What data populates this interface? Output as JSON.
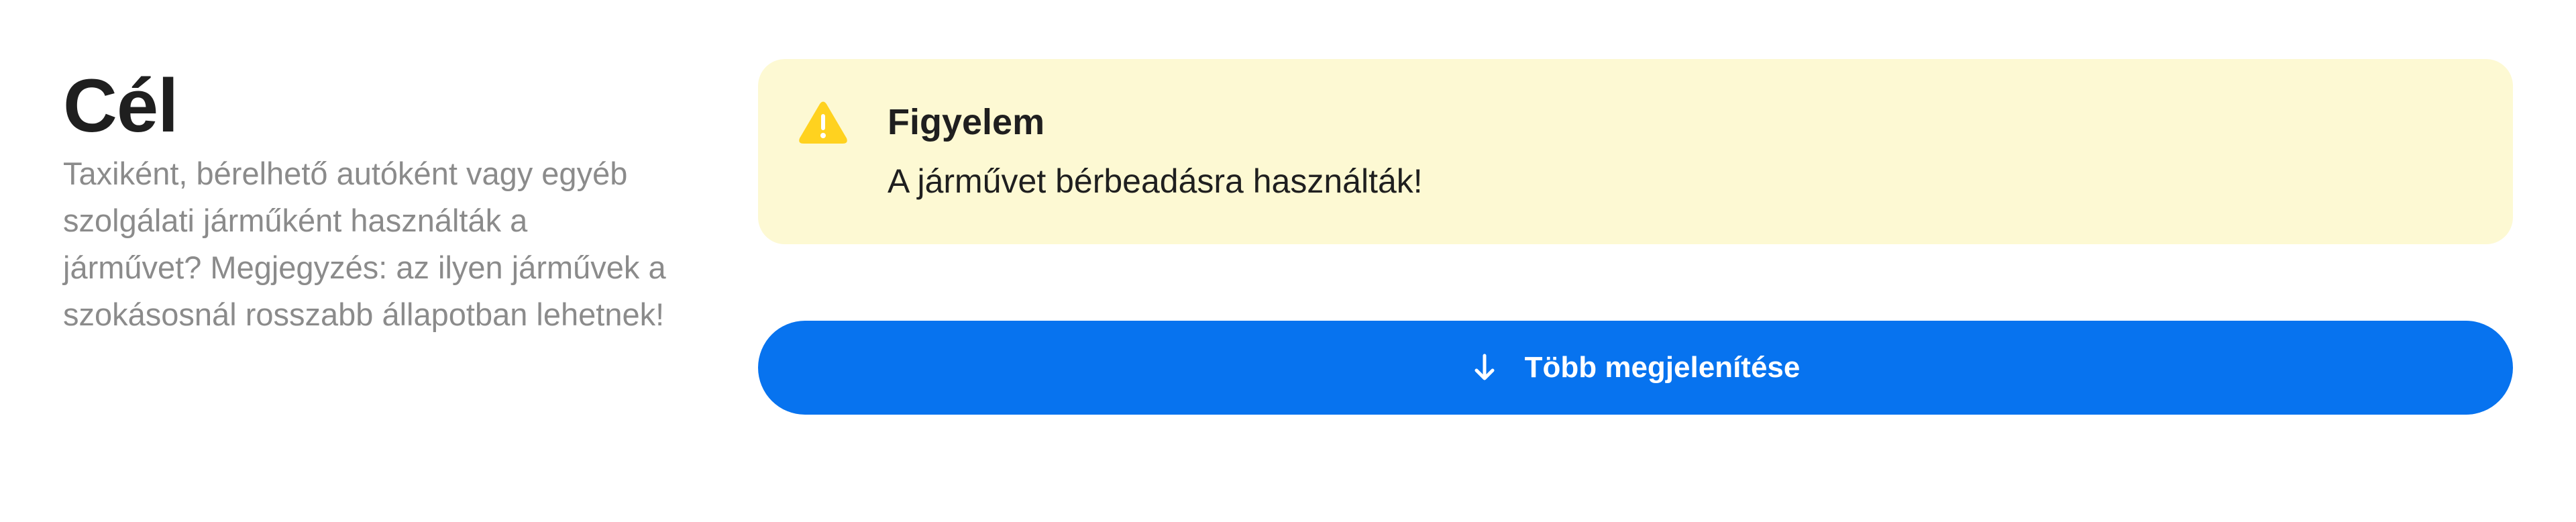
{
  "section": {
    "title": "Cél",
    "description": "Taxiként, bérelhető autóként vagy egyéb szolgálati járműként használták a járművet? Megjegyzés: az ilyen járművek a szokásosnál rosszabb állapotban lehetnek!"
  },
  "alert": {
    "icon": "warning-icon",
    "title": "Figyelem",
    "message": "A járművet bérbeadásra használták!",
    "background_color": "#fdf9d3",
    "icon_color": "#ffd21f"
  },
  "more_button": {
    "icon": "arrow-down-icon",
    "label": "Több megjelenítése",
    "color": "#0773ef"
  }
}
